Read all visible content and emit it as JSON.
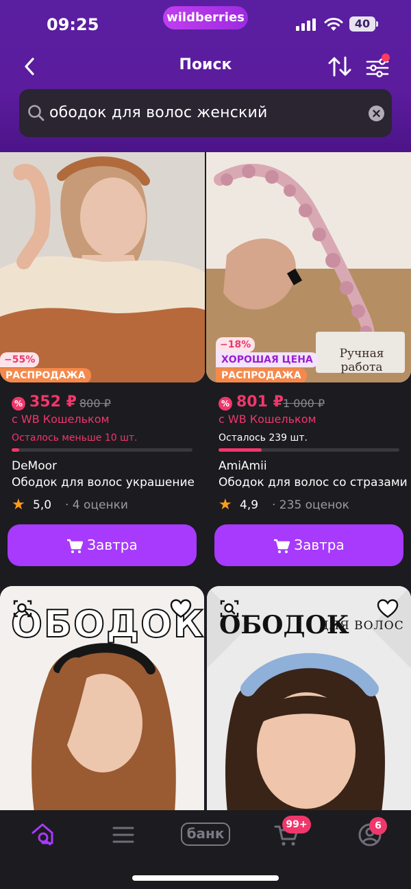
{
  "status_bar": {
    "time": "09:25",
    "brand": "wildberries",
    "battery": "40"
  },
  "nav": {
    "title": "Поиск"
  },
  "search": {
    "query": "ободок для волос женский"
  },
  "products": [
    {
      "discount_badge": "−55%",
      "sale_badge": "РАСПРОДАЖА",
      "price": "352 ₽",
      "old_price": "800 ₽",
      "wallet_label": "с WB Кошельком",
      "stock": "Осталось меньше 10 шт.",
      "stock_color": "#f0376b",
      "stock_fill": 0.04,
      "brand": "DeMoor",
      "name": "Ободок для волос украшение",
      "rating": "5,0",
      "reviews": "· 4 оценки",
      "button": "Завтра"
    },
    {
      "discount_badge": "−18%",
      "good_price_badge": "ХОРОШАЯ ЦЕНА",
      "sale_badge": "РАСПРОДАЖА",
      "image_caption_line1": "Ручная",
      "image_caption_line2": "работа",
      "price": "801 ₽",
      "old_price": "1 000 ₽",
      "wallet_label": "с WB Кошельком",
      "stock": "Осталось 239 шт.",
      "stock_color": "#ffffff",
      "stock_fill": 0.24,
      "brand": "AmiAmii",
      "name": "Ободок для волос со стразами",
      "rating": "4,9",
      "reviews": "· 235 оценок",
      "button": "Завтра"
    }
  ],
  "next_row": [
    {
      "image_title": "ОБОДОК"
    },
    {
      "image_title": "ОБОДОК",
      "image_subtitle": "ДЛЯ ВОЛОС"
    }
  ],
  "bottom_nav": {
    "bank_label": "банк",
    "cart_badge": "99+",
    "profile_badge": "6"
  },
  "icons": [
    "back-icon",
    "sort-icon",
    "filter-icon",
    "search-icon",
    "clear-icon",
    "cart-icon",
    "star-icon",
    "similar-icon",
    "heart-icon",
    "home-icon",
    "catalog-icon",
    "profile-icon"
  ],
  "colors": {
    "accent": "#a73afd",
    "price": "#f0376b",
    "header": "#5a1fa0",
    "sale": "#f5894b"
  }
}
